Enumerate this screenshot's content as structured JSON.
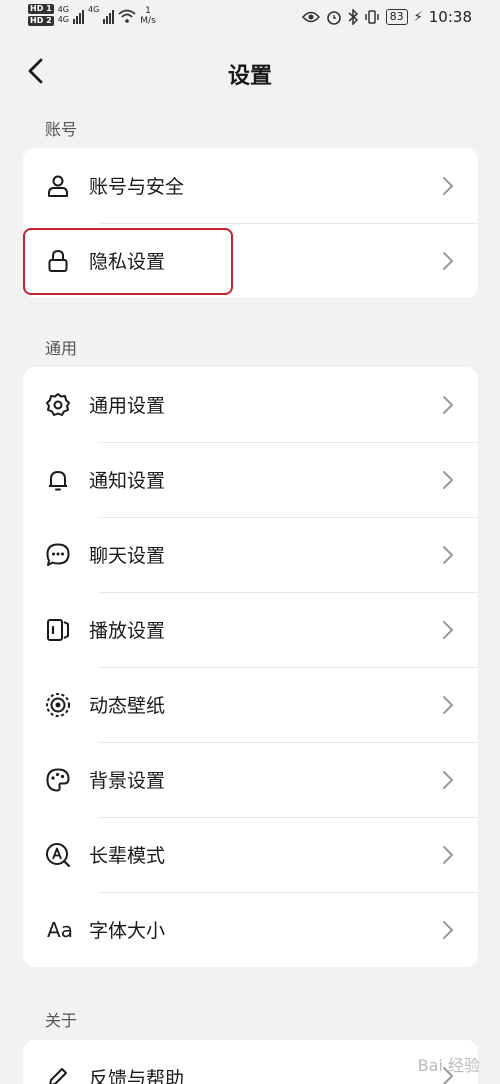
{
  "status_bar": {
    "hd_top": "HD 1",
    "hd_bottom": "HD 2",
    "net_top": "4G",
    "net_bottom": "4G",
    "speed_value": "1",
    "speed_unit": "M/s",
    "battery": "83",
    "time": "10:38"
  },
  "navbar": {
    "title": "设置"
  },
  "sections": {
    "account": {
      "label": "账号",
      "items": [
        {
          "label": "账号与安全",
          "icon": "person-icon"
        },
        {
          "label": "隐私设置",
          "icon": "lock-icon"
        }
      ]
    },
    "general": {
      "label": "通用",
      "items": [
        {
          "label": "通用设置",
          "icon": "gear-icon"
        },
        {
          "label": "通知设置",
          "icon": "bell-icon"
        },
        {
          "label": "聊天设置",
          "icon": "chat-bubble-icon"
        },
        {
          "label": "播放设置",
          "icon": "playback-icon"
        },
        {
          "label": "动态壁纸",
          "icon": "live-wallpaper-icon"
        },
        {
          "label": "背景设置",
          "icon": "palette-icon"
        },
        {
          "label": "长辈模式",
          "icon": "elder-mode-icon"
        },
        {
          "label": "字体大小",
          "icon": "font-size-icon"
        }
      ]
    },
    "about": {
      "label": "关于",
      "items": [
        {
          "label": "反馈与帮助",
          "icon": "pencil-icon"
        }
      ]
    }
  },
  "watermark": "Bai 经验",
  "colors": {
    "background": "#f2f2f2",
    "card": "#ffffff",
    "highlight": "#c8232c"
  }
}
